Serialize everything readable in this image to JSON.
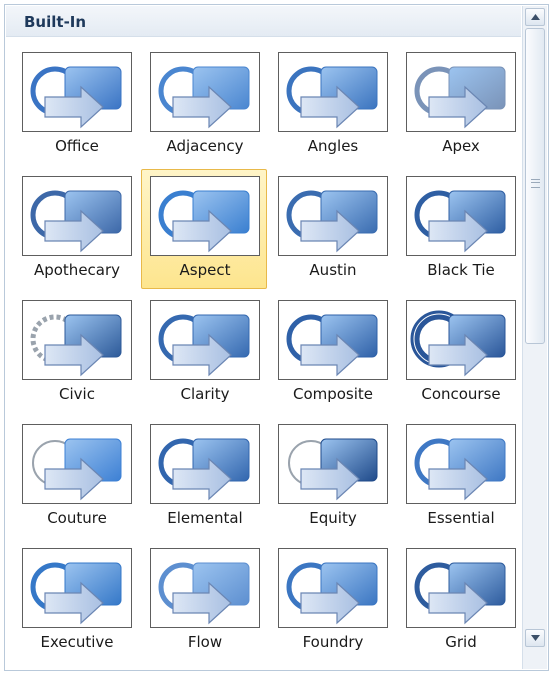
{
  "gallery": {
    "section_title": "Built-In",
    "selected_theme": "Aspect",
    "themes": [
      {
        "name": "Office",
        "accent": "#3a74c4",
        "style": "solid"
      },
      {
        "name": "Adjacency",
        "accent": "#4a86d0",
        "style": "solid"
      },
      {
        "name": "Angles",
        "accent": "#3b74bf",
        "style": "solid"
      },
      {
        "name": "Apex",
        "accent": "#7a93b8",
        "style": "solid"
      },
      {
        "name": "Apothecary",
        "accent": "#3d68a8",
        "style": "solid"
      },
      {
        "name": "Aspect",
        "accent": "#3a7fd0",
        "style": "solid"
      },
      {
        "name": "Austin",
        "accent": "#3a6cb0",
        "style": "solid"
      },
      {
        "name": "Black Tie",
        "accent": "#2f5fa3",
        "style": "solid"
      },
      {
        "name": "Civic",
        "accent": "#2d5a99",
        "style": "dashed"
      },
      {
        "name": "Clarity",
        "accent": "#3569b0",
        "style": "solid"
      },
      {
        "name": "Composite",
        "accent": "#2f61a8",
        "style": "solid"
      },
      {
        "name": "Concourse",
        "accent": "#2a5699",
        "style": "double"
      },
      {
        "name": "Couture",
        "accent": "#3d80d4",
        "style": "thin"
      },
      {
        "name": "Elemental",
        "accent": "#3266ae",
        "style": "solid"
      },
      {
        "name": "Equity",
        "accent": "#1f4a8a",
        "style": "thin"
      },
      {
        "name": "Essential",
        "accent": "#3f78c4",
        "style": "solid"
      },
      {
        "name": "Executive",
        "accent": "#3578c8",
        "style": "solid"
      },
      {
        "name": "Flow",
        "accent": "#5d8fd0",
        "style": "solid"
      },
      {
        "name": "Foundry",
        "accent": "#3b76c2",
        "style": "solid"
      },
      {
        "name": "Grid",
        "accent": "#2e5c9e",
        "style": "solid"
      }
    ]
  },
  "icons": {
    "scroll_up": "scroll-up-arrow-icon",
    "scroll_down": "scroll-down-arrow-icon",
    "thumbnail": "theme-preview-icon"
  }
}
